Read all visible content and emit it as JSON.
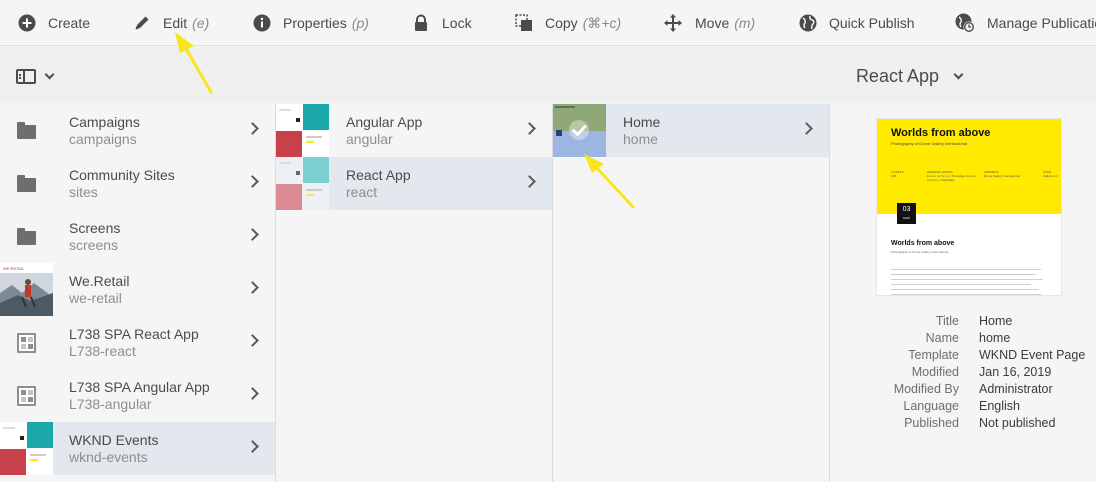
{
  "actionbar": {
    "create": {
      "label": "Create",
      "icon": "add-circle-icon"
    },
    "edit": {
      "label": "Edit",
      "shortcut": "(e)",
      "icon": "pencil-icon"
    },
    "properties": {
      "label": "Properties",
      "shortcut": "(p)",
      "icon": "info-circle-icon"
    },
    "lock": {
      "label": "Lock",
      "icon": "lock-icon"
    },
    "copy": {
      "label": "Copy",
      "shortcut": "(⌘+c)",
      "icon": "copy-icon"
    },
    "move": {
      "label": "Move",
      "shortcut": "(m)",
      "icon": "move-arrows-icon"
    },
    "quick_publish": {
      "label": "Quick Publish",
      "icon": "globe-icon"
    },
    "manage_publication": {
      "label": "Manage Publication",
      "icon": "globe-clock-icon"
    }
  },
  "titlebar": {
    "title": "React App"
  },
  "column1": [
    {
      "title": "Campaigns",
      "name": "campaigns",
      "thumbnail": "folder-icon"
    },
    {
      "title": "Community Sites",
      "name": "sites",
      "thumbnail": "folder-icon"
    },
    {
      "title": "Screens",
      "name": "screens",
      "thumbnail": "folder-icon"
    },
    {
      "title": "We.Retail",
      "name": "we-retail",
      "thumbnail": "photo"
    },
    {
      "title": "L738 SPA React App",
      "name": "L738-react",
      "thumbnail": "template-icon"
    },
    {
      "title": "L738 SPA Angular App",
      "name": "L738-angular",
      "thumbnail": "template-icon"
    },
    {
      "title": "WKND Events",
      "name": "wknd-events",
      "thumbnail": "page-thumbnail",
      "selected": true
    }
  ],
  "column2": [
    {
      "title": "Angular App",
      "name": "angular",
      "thumbnail": "page-thumbnail"
    },
    {
      "title": "React App",
      "name": "react",
      "thumbnail": "page-thumbnail",
      "selected": true
    }
  ],
  "column3": [
    {
      "title": "Home",
      "name": "home",
      "thumbnail": "page-thumbnail",
      "selected": true,
      "checked": true
    }
  ],
  "thumbnail_brand": "WE.RETAIL",
  "preview": {
    "card": {
      "heading": "Worlds from above",
      "subheading": "Photography of Drone Gallery International",
      "meta": [
        {
          "label": "TICKETS",
          "value": "10€"
        },
        {
          "label": "OPENING HOURS",
          "value": "11 a.m. to 5 p.m. | Thursdays 11 a.m. to 8 p.m. | Saturdays"
        },
        {
          "label": "ADDRESS",
          "value": "Drone Gallery International"
        },
        {
          "label": "TAGS",
          "value": "Gallery, Art"
        }
      ],
      "date_day": "03",
      "date_month": "MAR",
      "heading2": "Worlds from above",
      "subheading2": "Photography of Drone Gallery International"
    },
    "properties": [
      {
        "key": "Title",
        "value": "Home"
      },
      {
        "key": "Name",
        "value": "home"
      },
      {
        "key": "Template",
        "value": "WKND Event Page"
      },
      {
        "key": "Modified",
        "value": "Jan 16, 2019"
      },
      {
        "key": "Modified By",
        "value": "Administrator"
      },
      {
        "key": "Language",
        "value": "English"
      },
      {
        "key": "Published",
        "value": "Not published"
      }
    ]
  },
  "colors": {
    "selected_row": "#e3e7ee",
    "annotation_arrow": "#f7e61a",
    "card_yellow": "#ffea00"
  }
}
